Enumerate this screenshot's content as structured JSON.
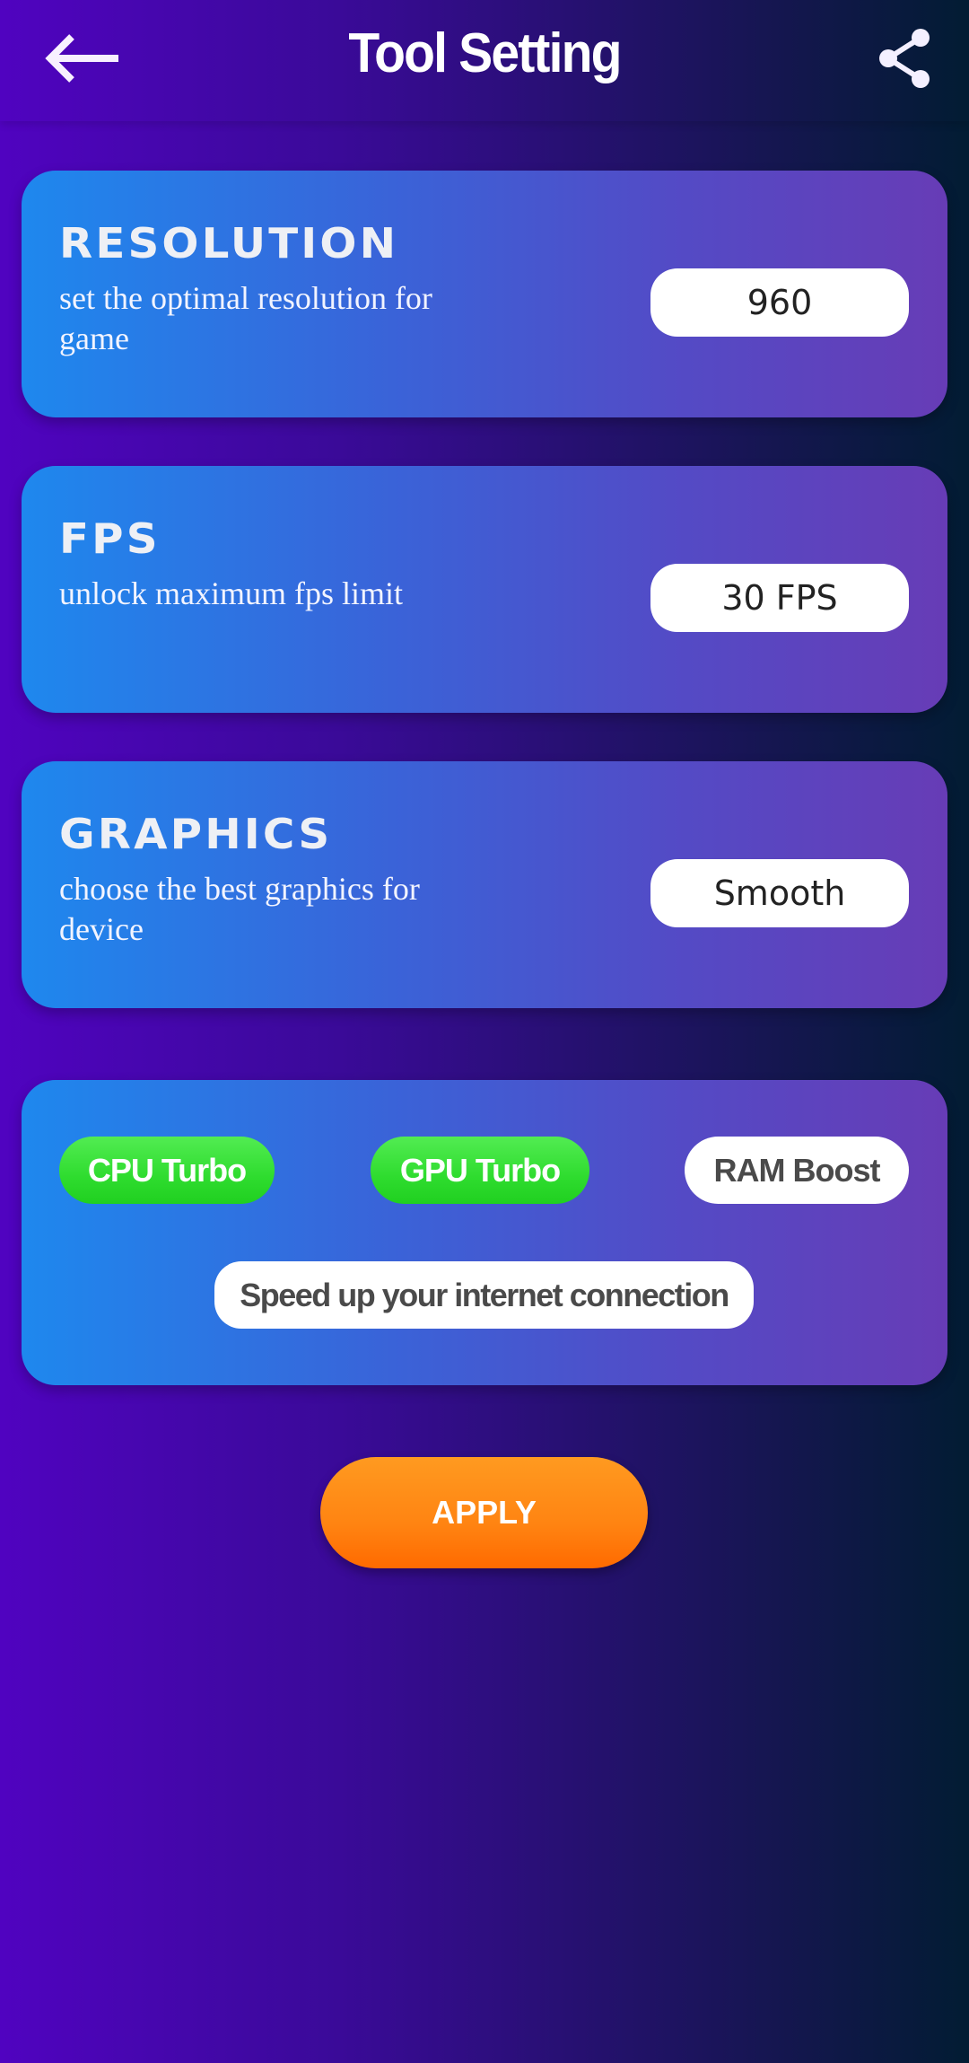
{
  "header": {
    "title": "Tool Setting",
    "back_icon": "arrow-left-icon",
    "share_icon": "share-icon"
  },
  "settings": [
    {
      "title": "RESOLUTION",
      "description": "set the optimal resolution for game",
      "value": "960"
    },
    {
      "title": "FPS",
      "description": "unlock maximum fps limit",
      "value": "30 FPS"
    },
    {
      "title": "GRAPHICS",
      "description": "choose the best graphics for device",
      "value": "Smooth"
    }
  ],
  "boosts": {
    "cpu_turbo": {
      "label": "CPU Turbo",
      "active": true
    },
    "gpu_turbo": {
      "label": "GPU Turbo",
      "active": true
    },
    "ram_boost": {
      "label": "RAM Boost",
      "active": false
    },
    "internet": {
      "label": "Speed up your internet connection",
      "active": false
    }
  },
  "apply_label": "APPLY",
  "colors": {
    "active_green": "#2fdc2f",
    "apply_orange": "#ff8412",
    "card_start": "#1e88ee",
    "card_end": "#673cb6"
  }
}
